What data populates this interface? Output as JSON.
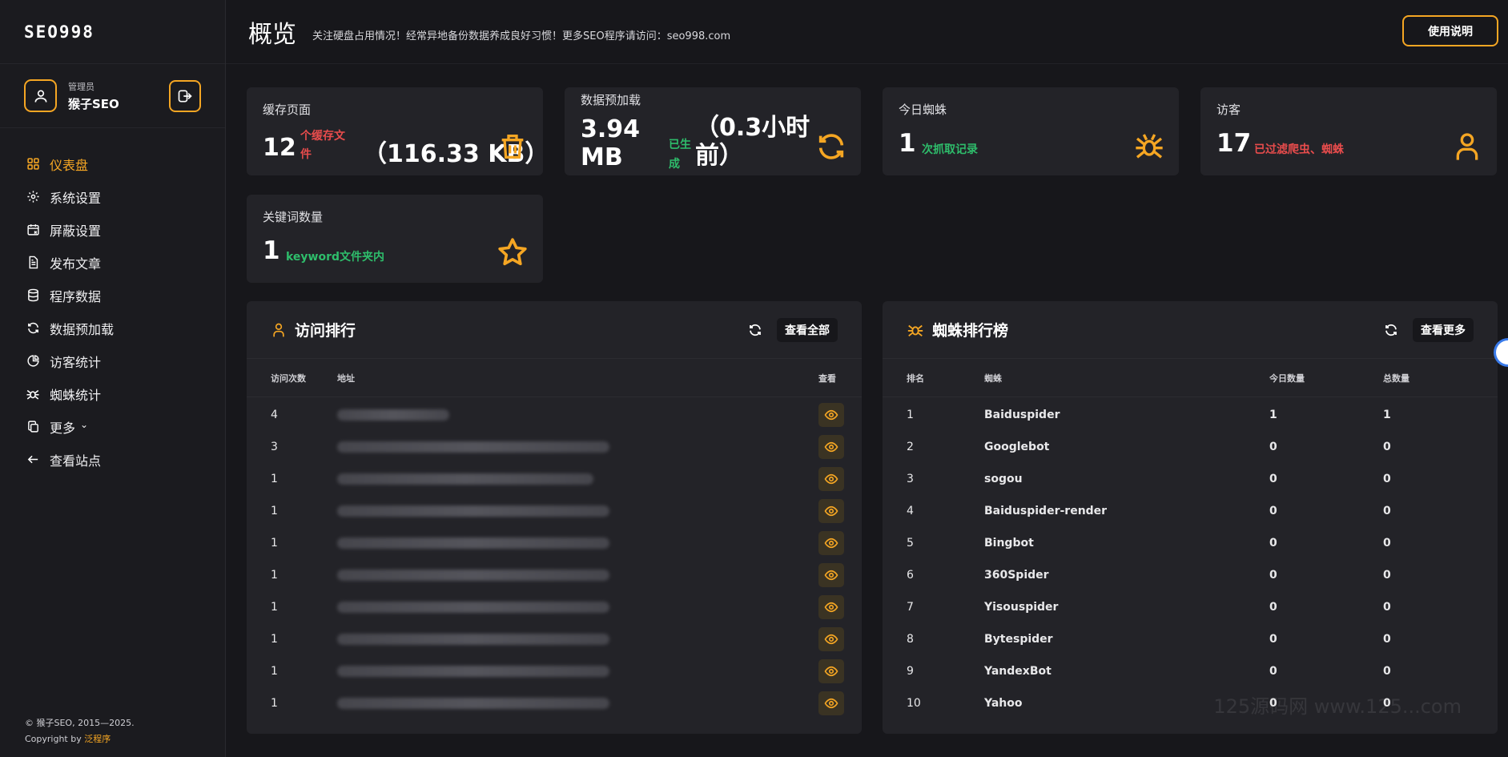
{
  "brand": {
    "logo": "SEO998"
  },
  "user": {
    "role": "管理员",
    "name": "猴子SEO"
  },
  "nav": [
    {
      "label": "仪表盘",
      "icon": "grid-icon",
      "active": true
    },
    {
      "label": "系统设置",
      "icon": "gear-icon"
    },
    {
      "label": "屏蔽设置",
      "icon": "calendar-block-icon"
    },
    {
      "label": "发布文章",
      "icon": "document-icon"
    },
    {
      "label": "程序数据",
      "icon": "database-icon"
    },
    {
      "label": "数据预加载",
      "icon": "refresh-icon"
    },
    {
      "label": "访客统计",
      "icon": "pie-chart-icon"
    },
    {
      "label": "蜘蛛统计",
      "icon": "spider-icon"
    },
    {
      "label": "更多",
      "icon": "copy-icon",
      "chevron": "⌄"
    },
    {
      "label": "查看站点",
      "icon": "arrow-left-icon"
    }
  ],
  "footer": {
    "line1": "© 猴子SEO, 2015—2025.",
    "line2_prefix": "Copyright by ",
    "line2_link": "泛程序"
  },
  "header": {
    "title": "概览",
    "subtitle": "关注硬盘占用情况！经常异地备份数据养成良好习惯！更多SEO程序请访问：seo998.com",
    "help_button": "使用说明"
  },
  "stats": {
    "cache": {
      "label": "缓存页面",
      "value": "12",
      "unit_line1": "个缓存文",
      "unit_line2": "件",
      "size": "（116.33 KB）",
      "icon": "trash-icon"
    },
    "preload": {
      "label": "数据预加载",
      "value_line1": "3.94",
      "value_line2": "MB",
      "status_line1": "已生",
      "status_line2": "成",
      "time_line1": "（0.3小时",
      "time_line2": "前）",
      "icon": "refresh-icon"
    },
    "spider": {
      "label": "今日蜘蛛",
      "value": "1",
      "note": "次抓取记录",
      "icon": "spider-icon"
    },
    "visitor": {
      "label": "访客",
      "value": "17",
      "note": "已过滤爬虫、蜘蛛",
      "icon": "user-icon"
    },
    "keywords": {
      "label": "关键词数量",
      "value": "1",
      "note": "keyword文件夹内",
      "icon": "star-icon"
    }
  },
  "visit_rank": {
    "title": "访问排行",
    "view_all": "查看全部",
    "columns": [
      "访问次数",
      "地址",
      "查看"
    ],
    "rows": [
      "4",
      "3",
      "1",
      "1",
      "1",
      "1",
      "1",
      "1",
      "1",
      "1"
    ]
  },
  "spider_rank": {
    "title": "蜘蛛排行榜",
    "view_more": "查看更多",
    "columns": [
      "排名",
      "蜘蛛",
      "今日数量",
      "总数量"
    ],
    "rows": [
      [
        "1",
        "Baiduspider",
        "1",
        "1"
      ],
      [
        "2",
        "Googlebot",
        "0",
        "0"
      ],
      [
        "3",
        "sogou",
        "0",
        "0"
      ],
      [
        "4",
        "Baiduspider-render",
        "0",
        "0"
      ],
      [
        "5",
        "Bingbot",
        "0",
        "0"
      ],
      [
        "6",
        "360Spider",
        "0",
        "0"
      ],
      [
        "7",
        "Yisouspider",
        "0",
        "0"
      ],
      [
        "8",
        "Bytespider",
        "0",
        "0"
      ],
      [
        "9",
        "YandexBot",
        "0",
        "0"
      ],
      [
        "10",
        "Yahoo",
        "0",
        "0"
      ]
    ]
  },
  "watermark": "125源码网 www.125...com",
  "colors": {
    "accent": "#f5a623",
    "danger": "#e84c4c",
    "success": "#2ebd6b",
    "background": "#17171b",
    "card": "#232328"
  }
}
